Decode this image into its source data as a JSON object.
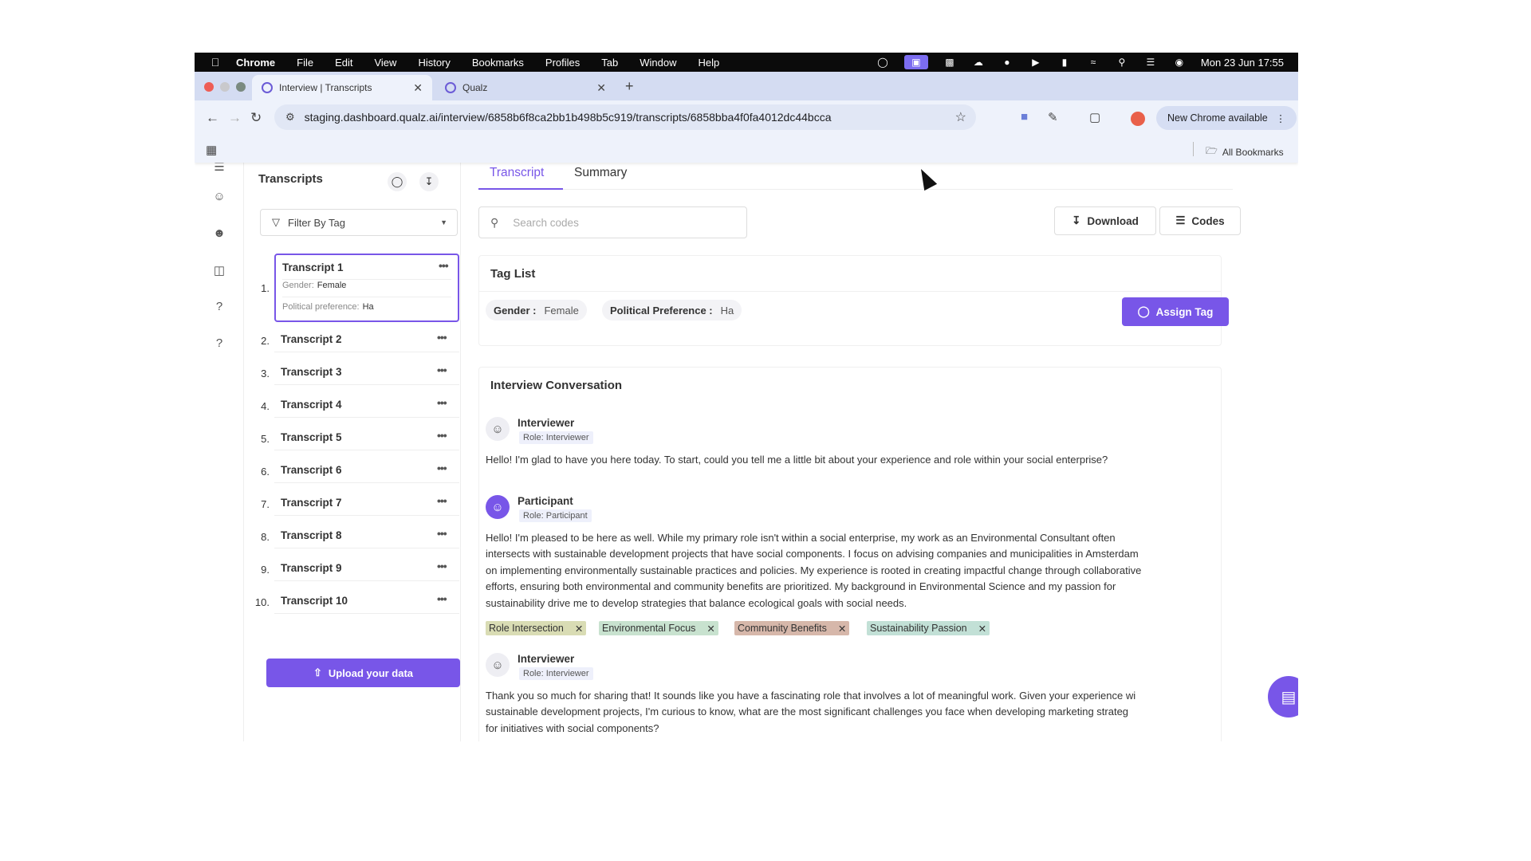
{
  "menubar": {
    "app": "Chrome",
    "items": [
      "File",
      "Edit",
      "View",
      "History",
      "Bookmarks",
      "Profiles",
      "Tab",
      "Window",
      "Help"
    ],
    "datetime": "Mon 23 Jun  17:55"
  },
  "browser": {
    "tabs": [
      {
        "title": "Interview | Transcripts"
      },
      {
        "title": "Qualz"
      }
    ],
    "url": "staging.dashboard.qualz.ai/interview/6858b6f8ca2bb1b498b5c919/transcripts/6858bba4f0fa4012dc44bcca",
    "new_chrome_label": "New Chrome available",
    "all_bookmarks_label": "All Bookmarks"
  },
  "transcripts_panel": {
    "title": "Transcripts",
    "filter_label": "Filter By Tag",
    "selected": {
      "gender_label": "Gender:",
      "gender_value": "Female",
      "political_label": "Political preference:",
      "political_value": "Ha"
    },
    "items": [
      {
        "num": "1.",
        "name": "Transcript 1"
      },
      {
        "num": "2.",
        "name": "Transcript 2"
      },
      {
        "num": "3.",
        "name": "Transcript 3"
      },
      {
        "num": "4.",
        "name": "Transcript 4"
      },
      {
        "num": "5.",
        "name": "Transcript 5"
      },
      {
        "num": "6.",
        "name": "Transcript 6"
      },
      {
        "num": "7.",
        "name": "Transcript 7"
      },
      {
        "num": "8.",
        "name": "Transcript 8"
      },
      {
        "num": "9.",
        "name": "Transcript 9"
      },
      {
        "num": "10.",
        "name": "Transcript 10"
      }
    ],
    "more_glyph": "•••",
    "upload_label": "Upload your data"
  },
  "main": {
    "tabs": [
      "Transcript",
      "Summary"
    ],
    "search_placeholder": "Search codes",
    "download_label": "Download",
    "codes_label": "Codes",
    "tag_list": {
      "title": "Tag List",
      "tags": [
        {
          "key": "Gender :",
          "value": "Female"
        },
        {
          "key": "Political Preference :",
          "value": "Ha"
        }
      ],
      "assign_label": "Assign Tag"
    },
    "conversation": {
      "title": "Interview Conversation",
      "turns": [
        {
          "speaker": "Interviewer",
          "role": "Role: Interviewer",
          "lines": [
            "Hello! I'm glad to have you here today. To start, could you tell me a little bit about your experience and role within your social enterprise?"
          ]
        },
        {
          "speaker": "Participant",
          "role": "Role: Participant",
          "lines": [
            "Hello! I'm pleased to be here as well. While my primary role isn't within a social enterprise, my work as an Environmental Consultant often",
            "intersects with sustainable development projects that have social components. I focus on advising companies and municipalities in Amsterdam",
            "on implementing environmentally sustainable practices and policies. My experience is rooted in creating impactful change through collaborative",
            "efforts, ensuring both environmental and community benefits are prioritized. My background in Environmental Science and my passion for",
            "sustainability drive me to develop strategies that balance ecological goals with social needs."
          ],
          "codes": [
            {
              "label": "Role Intersection",
              "color": "#d9dcb4"
            },
            {
              "label": "Environmental Focus",
              "color": "#c8e2cf"
            },
            {
              "label": "Community Benefits",
              "color": "#d6b7aa"
            },
            {
              "label": "Sustainability Passion",
              "color": "#c2e0d6"
            }
          ]
        },
        {
          "speaker": "Interviewer",
          "role": "Role: Interviewer",
          "lines": [
            "Thank you so much for sharing that! It sounds like you have a fascinating role that involves a lot of meaningful work. Given your experience wi",
            "sustainable development projects, I'm curious to know, what are the most significant challenges you face when developing marketing strateg",
            "for initiatives with social components?"
          ]
        }
      ]
    }
  },
  "colors": {
    "accent": "#7856e8",
    "menubar": "#0b0b0b",
    "tabstrip": "#d4dcf2"
  },
  "icons": {
    "apple": "apple-icon",
    "chat": "chat-icon",
    "tag": "tag-icon",
    "download": "download-icon"
  }
}
